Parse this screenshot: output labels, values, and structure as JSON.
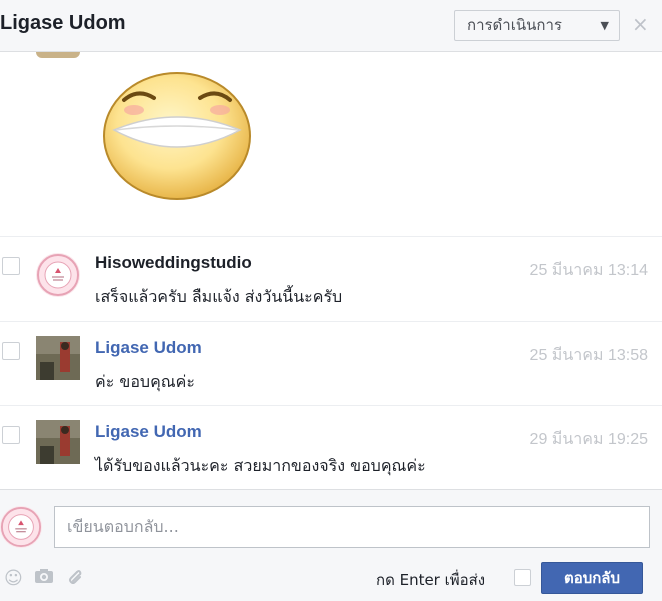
{
  "header": {
    "title": "Ligase Udom",
    "actions_label": "การดำเนินการ",
    "close_label": "×"
  },
  "messages": [
    {
      "sender": "Hisoweddingstudio",
      "time": "25 มีนาคม 13:14",
      "text": "เสร็จแล้วครับ ลืมแจ้ง ส่งวันนี้นะครับ"
    },
    {
      "sender": "Ligase Udom",
      "time": "25 มีนาคม 13:58",
      "text": "ค่ะ ขอบคุณค่ะ"
    },
    {
      "sender": "Ligase Udom",
      "time": "29 มีนาคม 19:25",
      "text": "ได้รับของแล้วนะคะ สวยมากของจริง ขอบคุณค่ะ"
    }
  ],
  "composer": {
    "placeholder": "เขียนตอบกลับ...",
    "enter_label": "กด Enter เพื่อส่ง",
    "reply_label": "ตอบกลับ"
  },
  "icons": [
    "emoji-icon",
    "camera-icon",
    "paperclip-icon"
  ],
  "colors": {
    "accent": "#4267b2",
    "name_link": "#4267b2",
    "timestamp": "#c3c6cb"
  }
}
